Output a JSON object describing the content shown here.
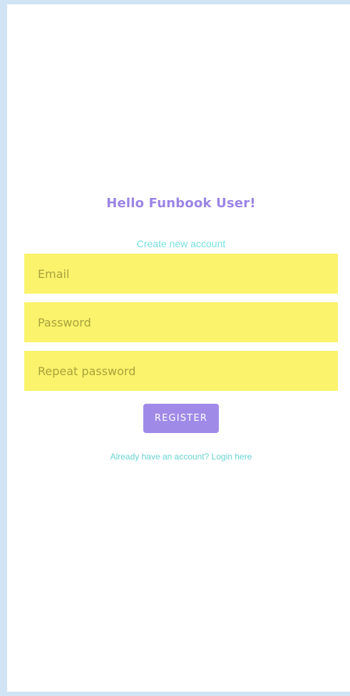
{
  "header": {
    "title": "Hello Funbook User!",
    "subtitle": "Create new account"
  },
  "form": {
    "email_placeholder": "Email",
    "email_value": "",
    "password_placeholder": "Password",
    "password_value": "",
    "repeat_password_placeholder": "Repeat password",
    "repeat_password_value": "",
    "register_label": "REGISTER"
  },
  "footer": {
    "login_link": "Already have an account? Login here"
  },
  "colors": {
    "background": "#d1e4f6",
    "card": "#ffffff",
    "title": "#9b84e6",
    "accent_text": "#74e0de",
    "field_bg": "#faf36b",
    "field_text": "#a8a23e",
    "button_bg": "#9f8ae8",
    "button_text": "#ffffff"
  }
}
